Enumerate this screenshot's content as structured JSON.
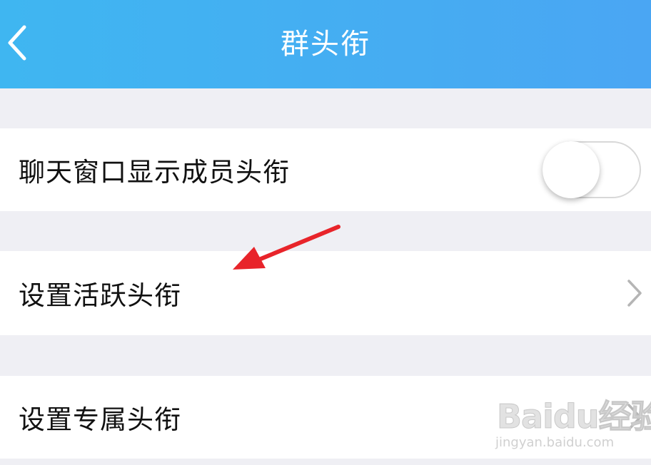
{
  "header": {
    "title": "群头衔",
    "background_color": "#44aef2",
    "back_icon": "chevron-left-icon"
  },
  "settings": {
    "show_member_title": {
      "label": "聊天窗口显示成员头衔",
      "enabled": false
    },
    "set_active_title": {
      "label": "设置活跃头衔",
      "icon": "chevron-right-icon"
    },
    "set_exclusive_title": {
      "label": "设置专属头衔",
      "icon": "chevron-right-icon"
    }
  },
  "annotation": {
    "icon": "red-arrow-pointer-icon",
    "color": "#e8242a"
  },
  "watermark": {
    "logo_text": "Baidu经验",
    "url": "jingyan.baidu.com"
  }
}
